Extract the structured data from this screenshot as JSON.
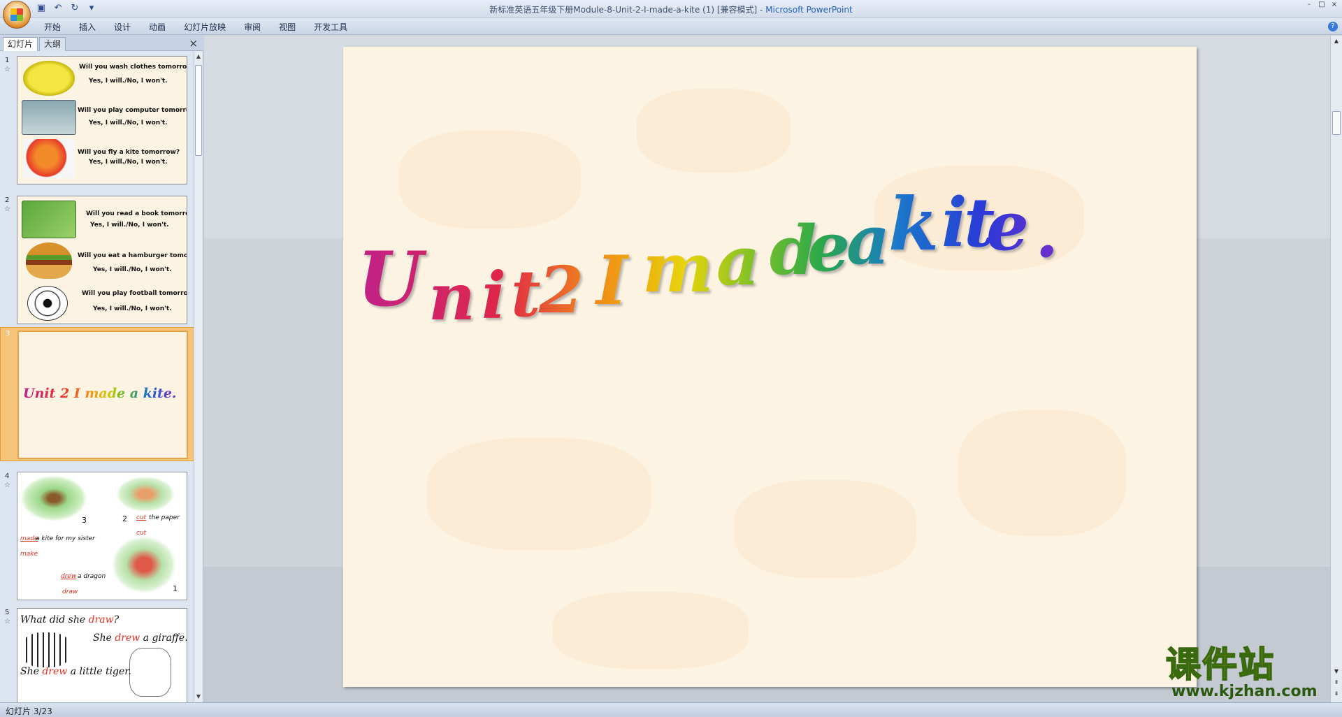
{
  "window": {
    "title": "新标准英语五年级下册Module-8-Unit-2-I-made-a-kite (1) [兼容模式] - ",
    "app_name": "Microsoft PowerPoint",
    "controls": [
      "-",
      "□",
      "×"
    ]
  },
  "qat": [
    "save-icon",
    "undo-icon",
    "redo-icon",
    "customize-icon"
  ],
  "ribbon": {
    "tabs": [
      "开始",
      "插入",
      "设计",
      "动画",
      "幻灯片放映",
      "审阅",
      "视图",
      "开发工具"
    ]
  },
  "panel": {
    "tab_slides": "幻灯片",
    "tab_outline": "大纲",
    "close": "×"
  },
  "thumbnails": [
    {
      "number": "1",
      "lines": [
        [
          "Will you wash clothes tomorrow?",
          "Yes, I will./No, I won't."
        ],
        [
          "Will you play computer tomorrow?",
          "Yes, I will./No, I won't."
        ],
        [
          "Will you fly a kite tomorrow?",
          "Yes, I will./No, I won't."
        ]
      ]
    },
    {
      "number": "2",
      "lines": [
        [
          "Will you read a book tomorrow?",
          "Yes, I will./No, I won't."
        ],
        [
          "Will you eat a hamburger tomorrow",
          "Yes, I will./No, I won't."
        ],
        [
          "Will you play football tomorrow?",
          "Yes, I will./No, I won't."
        ]
      ]
    },
    {
      "number": "3",
      "title": "Unit 2 I made a kite."
    },
    {
      "number": "4",
      "labels": [
        "3",
        "2",
        "1",
        "cut",
        "the paper",
        "cut",
        "made",
        "a kite for my sister",
        "make",
        "drew",
        "a dragon",
        "draw"
      ]
    },
    {
      "number": "5",
      "q_prefix": "What did she ",
      "q_red": "draw",
      "q_suffix": "?",
      "a1_prefix": "She ",
      "a1_red": "drew",
      "a1_suffix": " a giraffe.",
      "a2_prefix": "She ",
      "a2_red": "drew",
      "a2_suffix": " a little tiger."
    }
  ],
  "slide": {
    "title_letters": [
      "U",
      "n",
      "i",
      "t",
      "2",
      "I",
      "m",
      "a",
      "d",
      "e",
      "a",
      "k",
      "i",
      "t",
      "e",
      "."
    ],
    "title_text": "Unit 2 I made a kite."
  },
  "status": {
    "slide_counter": "幻灯片 3/23"
  },
  "watermark": {
    "text": "课件站",
    "url": "www.kjzhan.com"
  },
  "colors": {
    "slide_bg": "#fdf3e2",
    "selected_thumb": "#f7c57a",
    "wordart_gradient": [
      "#c0208a",
      "#e8302a",
      "#f08a1a",
      "#e8d40a",
      "#4ab42a",
      "#1a8ac8",
      "#2a3ad8",
      "#7a2ac8"
    ]
  }
}
